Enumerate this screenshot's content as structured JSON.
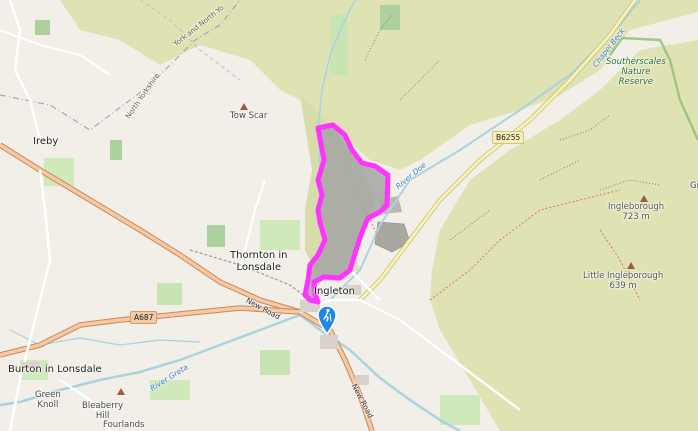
{
  "map": {
    "places": {
      "thornton": "Thornton in\nLonsdale",
      "burton": "Burton in Lonsdale",
      "ireby": "Ireby",
      "tow_scar": "Tow Scar",
      "ingleton": "Ingleton",
      "ingleborough": "Ingleborough\n723 m",
      "little_ingleborough": "Little Ingleborough\n639 m",
      "green_knoll": "Green\nKnoll",
      "bleaberry_hill": "Bleaberry\nHill",
      "fourlands": "Fourlands",
      "gr": "Gr",
      "southerscales": "Southerscales\nNature\nReserve"
    },
    "roads": {
      "a687": "A687",
      "b6255": "B6255",
      "new_road_1": "New Road",
      "new_road_2": "New Road"
    },
    "water": {
      "river_greta": "River Greta",
      "chapel_beck": "Chapel Beck",
      "river_doe": "River Doe"
    },
    "boundaries": {
      "north_yorkshire": "North Yorkshire",
      "york_and_north": "York and North Yo"
    },
    "colors": {
      "background": "#f2efe9",
      "moorland": "#dfe3b4",
      "route": "#ff33ff",
      "route_fill": "#a4a4a4",
      "water": "#aad3df",
      "a_road": "#f8c8a0",
      "b_road": "#f7f3b8",
      "marker": "#1e88e5"
    },
    "icons": {
      "marker": "hiking-marker-icon"
    }
  }
}
